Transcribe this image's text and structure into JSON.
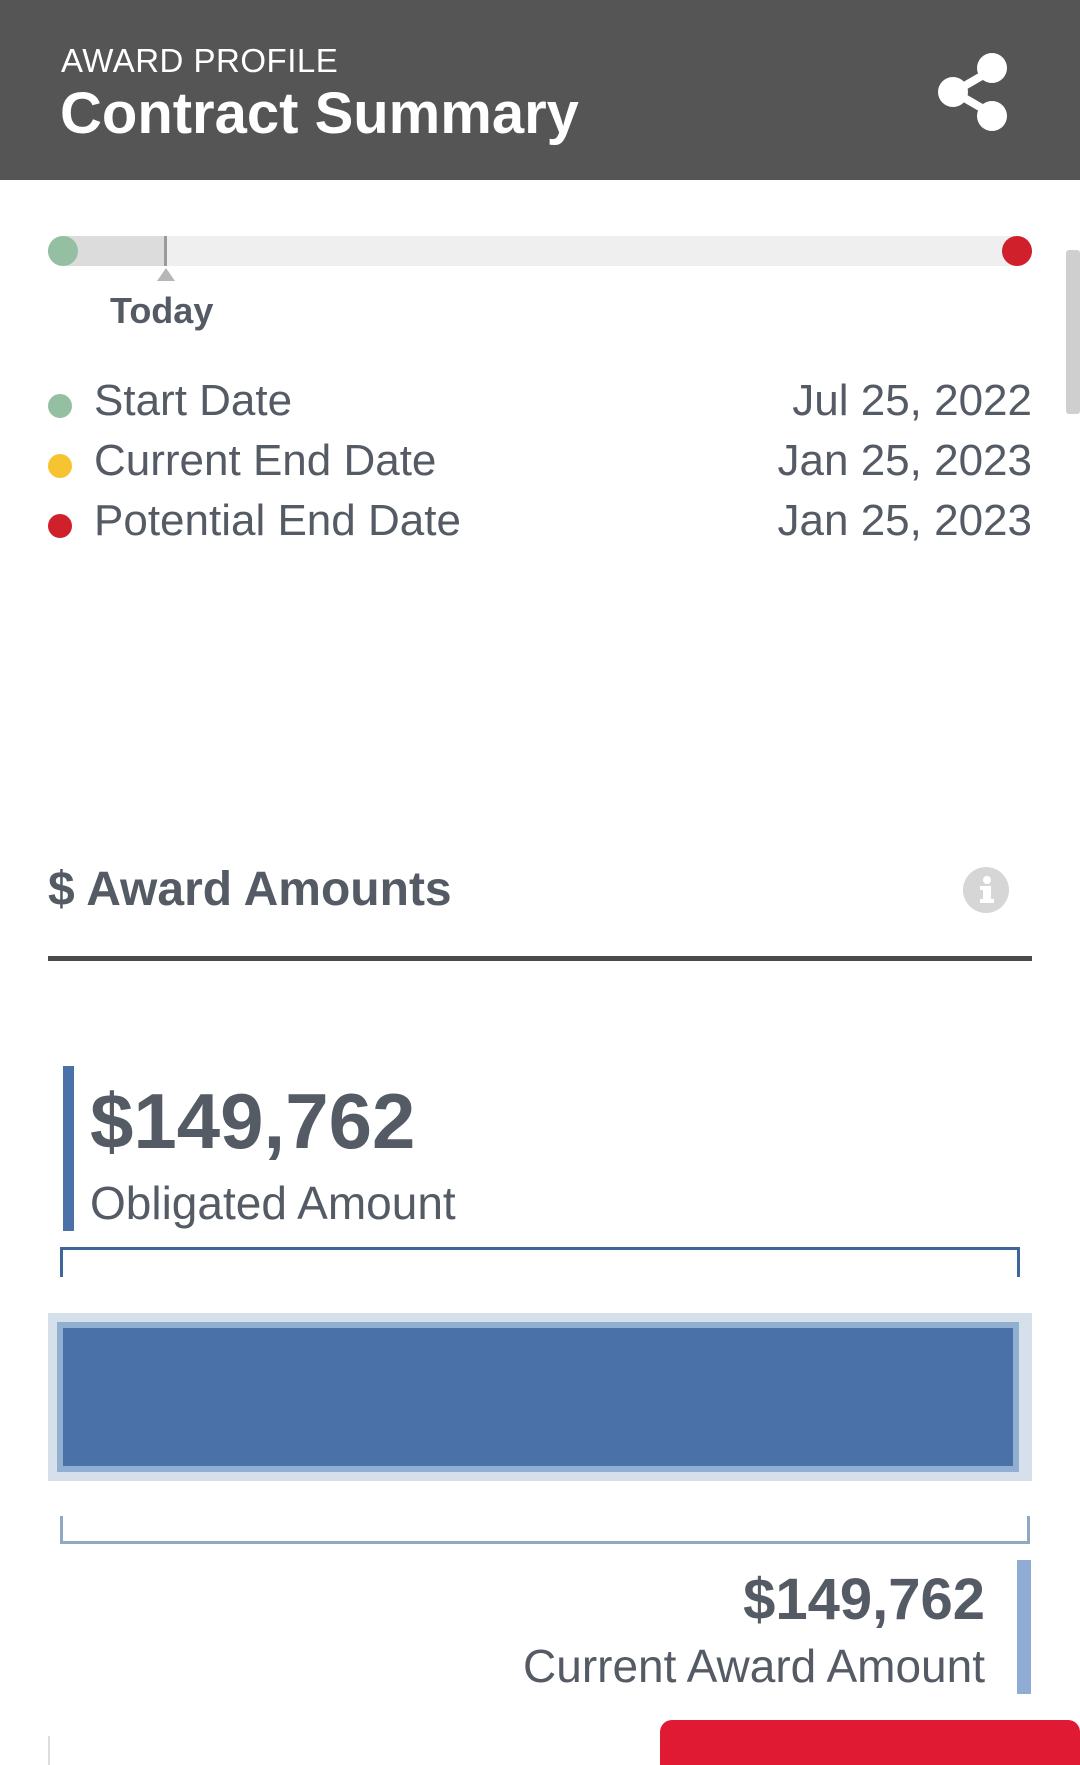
{
  "header": {
    "kicker": "AWARD PROFILE",
    "title": "Contract Summary",
    "share_icon": "share-icon"
  },
  "timeline": {
    "today_label": "Today",
    "elapsed_fraction": 0.12,
    "colors": {
      "start": "#94bfa2",
      "current_end": "#f7c431",
      "potential_end": "#d0202b"
    }
  },
  "dates": [
    {
      "label": "Start Date",
      "value": "Jul 25, 2022",
      "color": "#94bfa2"
    },
    {
      "label": "Current End Date",
      "value": "Jan 25, 2023",
      "color": "#f7c431"
    },
    {
      "label": "Potential End Date",
      "value": "Jan 25, 2023",
      "color": "#d0202b"
    }
  ],
  "award_amounts": {
    "title": "$ Award Amounts",
    "info_icon": "info-icon",
    "obligated": {
      "amount": "$149,762",
      "label": "Obligated Amount"
    },
    "current": {
      "amount": "$149,762",
      "label": "Current Award Amount"
    },
    "obligated_fraction": 1.0,
    "colors": {
      "obligated": "#4a72a8",
      "current": "#91acd4"
    }
  }
}
